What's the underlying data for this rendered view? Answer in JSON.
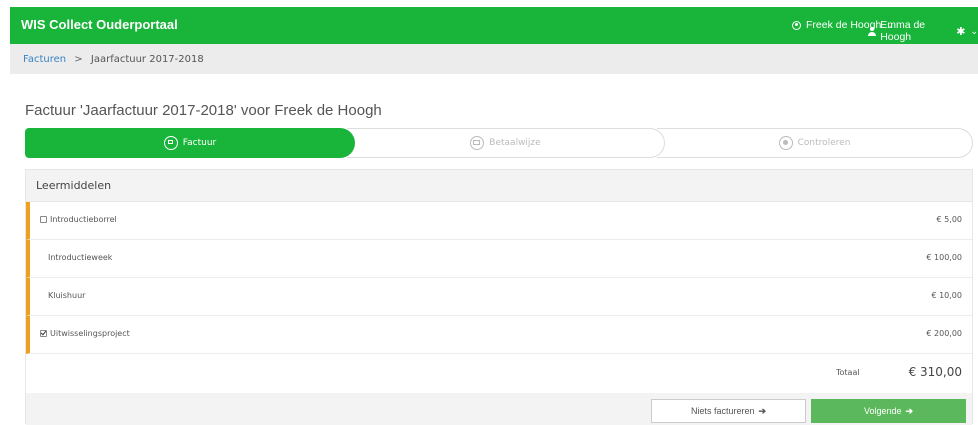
{
  "header": {
    "brand": "WIS Collect Ouderportaal",
    "user1": "Freek de Hoogh",
    "user2": "Emma de Hoogh"
  },
  "breadcrumb": {
    "link": "Facturen",
    "separator": ">",
    "current": "Jaarfactuur 2017-2018"
  },
  "page_title": "Factuur 'Jaarfactuur 2017-2018' voor Freek de Hoogh",
  "steps": [
    {
      "label": "Factuur",
      "icon": "cart-icon",
      "active": true
    },
    {
      "label": "Betaalwijze",
      "icon": "credit-card-icon",
      "active": false
    },
    {
      "label": "Controleren",
      "icon": "eye-icon",
      "active": false
    }
  ],
  "panel": {
    "title": "Leermiddelen",
    "items": [
      {
        "label": "Introductieborrel",
        "amount": "€ 5,00",
        "checkbox": true,
        "checked": false
      },
      {
        "label": "Introductieweek",
        "amount": "€ 100,00",
        "checkbox": false
      },
      {
        "label": "Kluishuur",
        "amount": "€ 10,00",
        "checkbox": false
      },
      {
        "label": "Uitwisselingsproject",
        "amount": "€ 200,00",
        "checkbox": true,
        "checked": true
      }
    ],
    "total_label": "Totaal",
    "total_value": "€ 310,00"
  },
  "buttons": {
    "skip": "Niets factureren",
    "next": "Volgende"
  },
  "colors": {
    "brand_green": "#19b53b",
    "button_green": "#5cb85c",
    "row_accent": "#f0a020"
  }
}
